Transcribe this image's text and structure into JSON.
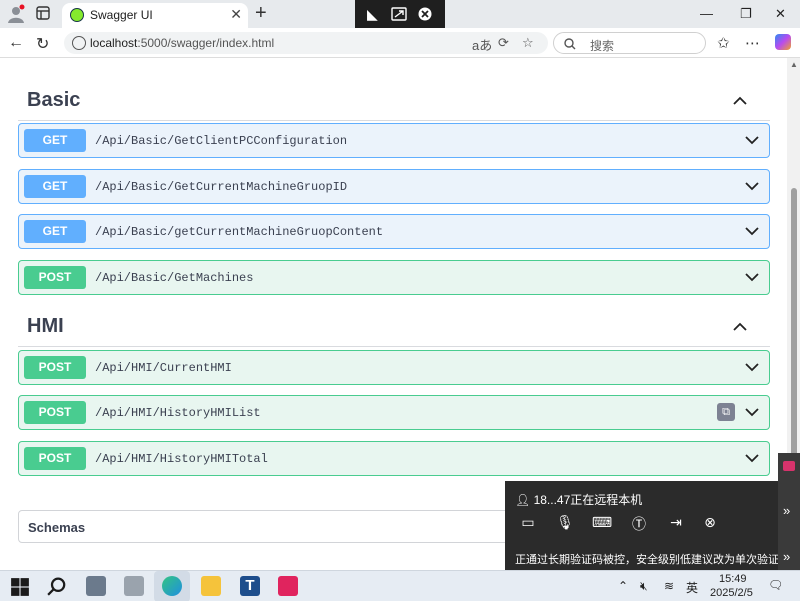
{
  "browser": {
    "tab_title": "Swagger UI",
    "tab_close": "✕",
    "new_tab": "+",
    "url_host": "localhost",
    "url_rest": ":5000/swagger/index.html",
    "search_placeholder": "搜索"
  },
  "sections": [
    {
      "title": "Basic",
      "operations": [
        {
          "method": "GET",
          "path": "/Api/Basic/GetClientPCConfiguration"
        },
        {
          "method": "GET",
          "path": "/Api/Basic/GetCurrentMachineGruopID"
        },
        {
          "method": "GET",
          "path": "/Api/Basic/getCurrentMachineGruopContent"
        },
        {
          "method": "POST",
          "path": "/Api/Basic/GetMachines"
        }
      ]
    },
    {
      "title": "HMI",
      "operations": [
        {
          "method": "POST",
          "path": "/Api/HMI/CurrentHMI"
        },
        {
          "method": "POST",
          "path": "/Api/HMI/HistoryHMIList"
        },
        {
          "method": "POST",
          "path": "/Api/HMI/HistoryHMITotal"
        }
      ]
    }
  ],
  "schemas_label": "Schemas",
  "remote": {
    "user_text": "18...47正在远程本机",
    "note": "正通过长期验证码被控，安全级别低建议改为单次验证码"
  },
  "taskbar": {
    "ime": "英",
    "time": "15:49",
    "date": "2025/2/5"
  },
  "colors": {
    "get": "#61affe",
    "post": "#49cc90",
    "get_bg": "#ebf3fb",
    "post_bg": "#e8f6f0"
  }
}
